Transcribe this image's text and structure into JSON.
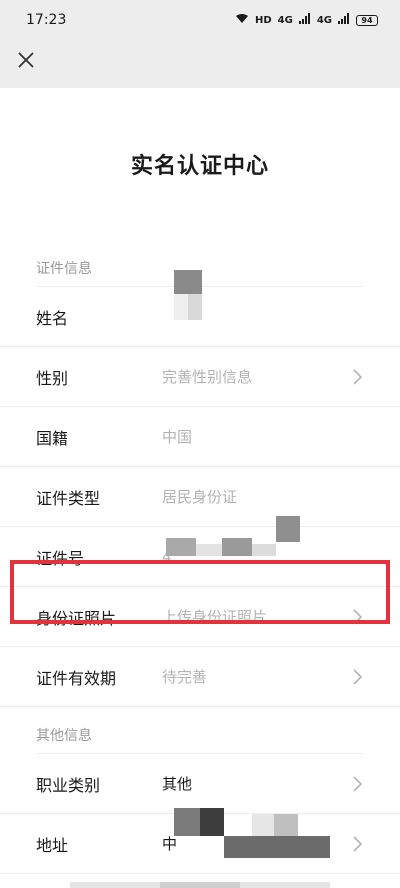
{
  "status_bar": {
    "time": "17:23",
    "hd_label": "HD",
    "signal1": "4G",
    "signal2": "4G",
    "battery": "94"
  },
  "nav": {
    "close_icon": "close-icon"
  },
  "page": {
    "title": "实名认证中心"
  },
  "sections": {
    "cert_info": "证件信息",
    "other_info": "其他信息"
  },
  "rows": {
    "name": {
      "label": "姓名",
      "value": ""
    },
    "gender": {
      "label": "性别",
      "value": "完善性别信息"
    },
    "nationality": {
      "label": "国籍",
      "value": "中国"
    },
    "id_type": {
      "label": "证件类型",
      "value": "居民身份证"
    },
    "id_number": {
      "label": "证件号",
      "value": "4"
    },
    "id_photo": {
      "label": "身份证照片",
      "value": "上传身份证照片"
    },
    "validity": {
      "label": "证件有效期",
      "value": "待完善"
    },
    "occupation": {
      "label": "职业类别",
      "value": "其他"
    },
    "address": {
      "label": "地址",
      "value": "中"
    }
  },
  "colors": {
    "highlight": "#e3323b",
    "header_bg": "#ededed",
    "placeholder": "#b3b3b3",
    "section_text": "#9a9a9a"
  }
}
